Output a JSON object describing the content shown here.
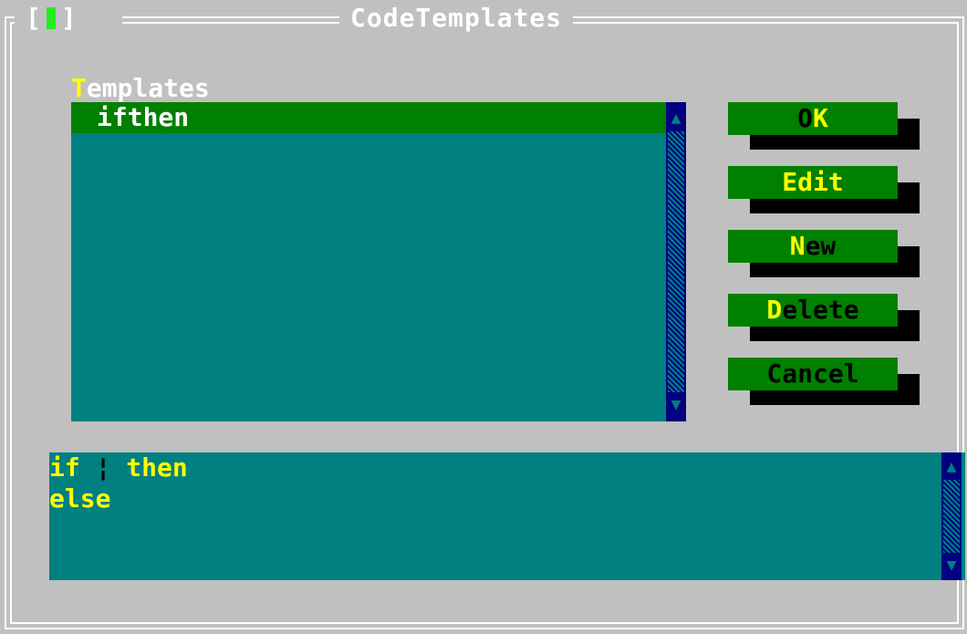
{
  "window": {
    "title": "CodeTemplates",
    "close_left": "[",
    "close_right": "]"
  },
  "templates_label": {
    "hotkey": "T",
    "rest": "emplates"
  },
  "templates_list": {
    "items": [
      {
        "label": "ifthen",
        "selected": true
      }
    ],
    "scroll_up": "▲",
    "scroll_down": "▼"
  },
  "buttons": [
    {
      "pre": "O",
      "hot": "K",
      "post": "",
      "focused": false
    },
    {
      "pre": "",
      "hot": "",
      "post": "Edit",
      "focused": true
    },
    {
      "pre": "",
      "hot": "N",
      "post": "ew",
      "focused": false
    },
    {
      "pre": "",
      "hot": "D",
      "post": "elete",
      "focused": false
    },
    {
      "pre": "",
      "hot": "",
      "post": "Cancel",
      "focused": false
    }
  ],
  "editor": {
    "line1_a": "if ",
    "line1_cursor": "¦",
    "line1_b": " then",
    "line2": "else",
    "scroll_up": "▲",
    "scroll_down": "▼"
  },
  "colors": {
    "desktop": "#c0c0c0",
    "list_bg": "#008080",
    "selection": "#008000",
    "button": "#008000",
    "hotkey": "#ffff00",
    "scrollbar": "#000080"
  }
}
